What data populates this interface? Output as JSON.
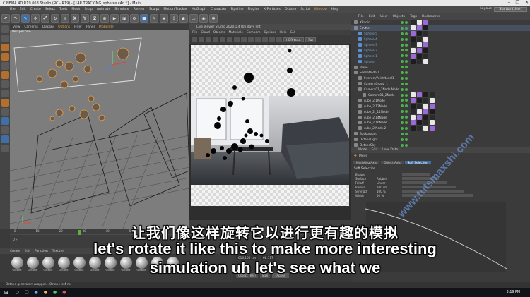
{
  "window": {
    "title": "CINEMA 4D R19.068 Studio (RC - R19) - [14R TRACKING_spheres.c4d *] - Main",
    "controls": [
      "–",
      "❐",
      "✕"
    ]
  },
  "menubar": {
    "items": [
      "File",
      "Edit",
      "Create",
      "Select",
      "Tools",
      "Mesh",
      "Snap",
      "Animate",
      "Simulate",
      "Render",
      "Sculpt",
      "Motion Tracker",
      "MoGraph",
      "Character",
      "Pipeline",
      "Plugins",
      "X-Particles",
      "Octane",
      "Script",
      "Window",
      "Help"
    ],
    "layout_label": "Layout:",
    "layout_value": "Startup (User)"
  },
  "toolbar": {
    "axis_x": "X",
    "axis_y": "Y",
    "axis_z": "Z"
  },
  "viewport": {
    "menu": [
      "View",
      "Cameras",
      "Display",
      "Options",
      "Filter",
      "Panel",
      "ProRender"
    ],
    "label": "Perspective"
  },
  "live_viewer": {
    "title": "Live Viewer Studio 2020.1.4 [0h days left]",
    "menu": [
      "File",
      "Cloud",
      "Objects",
      "Materials",
      "Compare",
      "Options",
      "Help",
      "GUI"
    ],
    "tonemap_dropdown": "HDR tone.",
    "mode_dropdown": "Pat"
  },
  "object_manager": {
    "tabs": [
      "File",
      "Edit",
      "View",
      "Objects",
      "Tags",
      "Bookmarks"
    ],
    "items": [
      {
        "name": "XRadio",
        "color": "#d0d0d0",
        "indent": 0
      },
      {
        "name": "Emitter",
        "color": "#e0e0e0",
        "indent": 0
      },
      {
        "name": "Sphere.5",
        "color": "#7aa3d8",
        "indent": 1
      },
      {
        "name": "Sphere.4",
        "color": "#7aa3d8",
        "indent": 1
      },
      {
        "name": "Sphere.3",
        "color": "#7aa3d8",
        "indent": 1
      },
      {
        "name": "Sphere.2",
        "color": "#7aa3d8",
        "indent": 1
      },
      {
        "name": "Sphere.1",
        "color": "#7aa3d8",
        "indent": 1
      },
      {
        "name": "Sphere",
        "color": "#7aa3d8",
        "indent": 1
      },
      {
        "name": "Plane",
        "color": "#d0d0d0",
        "indent": 0
      },
      {
        "name": "SceneNode.1",
        "color": "#d0d0d0",
        "indent": 0
      },
      {
        "name": "Interest/PointNodel1",
        "color": "#d0d0d0",
        "indent": 1
      },
      {
        "name": "CameraGroup_1",
        "color": "#d0d0d0",
        "indent": 1
      },
      {
        "name": "Camera01_2Node Node",
        "color": "#d0d0d0",
        "indent": 1
      },
      {
        "name": "Camera01_2Node",
        "color": "#d0d0d0",
        "indent": 2
      },
      {
        "name": "cube_2 1Node",
        "color": "#d0d0d0",
        "indent": 1
      },
      {
        "name": "cube_2 12Node",
        "color": "#d0d0d0",
        "indent": 1
      },
      {
        "name": "cube_2 _11Node",
        "color": "#d0d0d0",
        "indent": 1
      },
      {
        "name": "cube_2 14Node",
        "color": "#d0d0d0",
        "indent": 1
      },
      {
        "name": "cube_2 16Node",
        "color": "#d0d0d0",
        "indent": 1
      },
      {
        "name": "cube_2 Node.2",
        "color": "#d0d0d0",
        "indent": 1
      },
      {
        "name": "Background",
        "color": "#d0d0d0",
        "indent": 0
      },
      {
        "name": "OctaneLight",
        "color": "#d0d0d0",
        "indent": 0
      },
      {
        "name": "OctaneSky",
        "color": "#d0d0d0",
        "indent": 0
      }
    ]
  },
  "attributes": {
    "tabs": [
      "Mode",
      "Edit",
      "User Data"
    ],
    "object_name": "Move",
    "subtabs": [
      "Modeling Axis",
      "Object Axis",
      "Soft Selection"
    ],
    "section": "Soft Selection",
    "params": [
      "Enable",
      "Surface",
      "Falloff",
      "Radius",
      "Strength",
      "Width"
    ],
    "param_values": [
      "",
      "Rubber",
      "Linear",
      "100 cm",
      "100 %",
      "50 %"
    ]
  },
  "timeline": {
    "ticks": [
      "0",
      "10",
      "20",
      "30",
      "40",
      "50",
      "60",
      "70",
      "80",
      "90"
    ],
    "frame": "0 F"
  },
  "material_manager": {
    "tabs": [
      "Create",
      "Edit",
      "Function",
      "Texture"
    ],
    "materials": [
      "Octane",
      "Octane",
      "Octane",
      "Octane",
      "Octane",
      "Octane",
      "Octane",
      "Octane",
      "Octane",
      "Octane",
      "Octane"
    ]
  },
  "coordinates": {
    "pos": "616.106 cm",
    "size": "68.717",
    "mode_dropdown": "Object (Rel)",
    "size_dropdown": "Size",
    "apply_label": "Apply"
  },
  "status_bar": "Octane generator: wrapper... Octane is 4 ms",
  "subtitles": {
    "chinese": "让我们像这样旋转它以进行更有趣的模拟",
    "english_line1": "let's rotate it like this to make more interesting",
    "english_line2": "simulation uh let's see what we"
  },
  "watermark": "www.tutsmaxshi.com",
  "taskbar": {
    "time": "3:19 PM"
  }
}
